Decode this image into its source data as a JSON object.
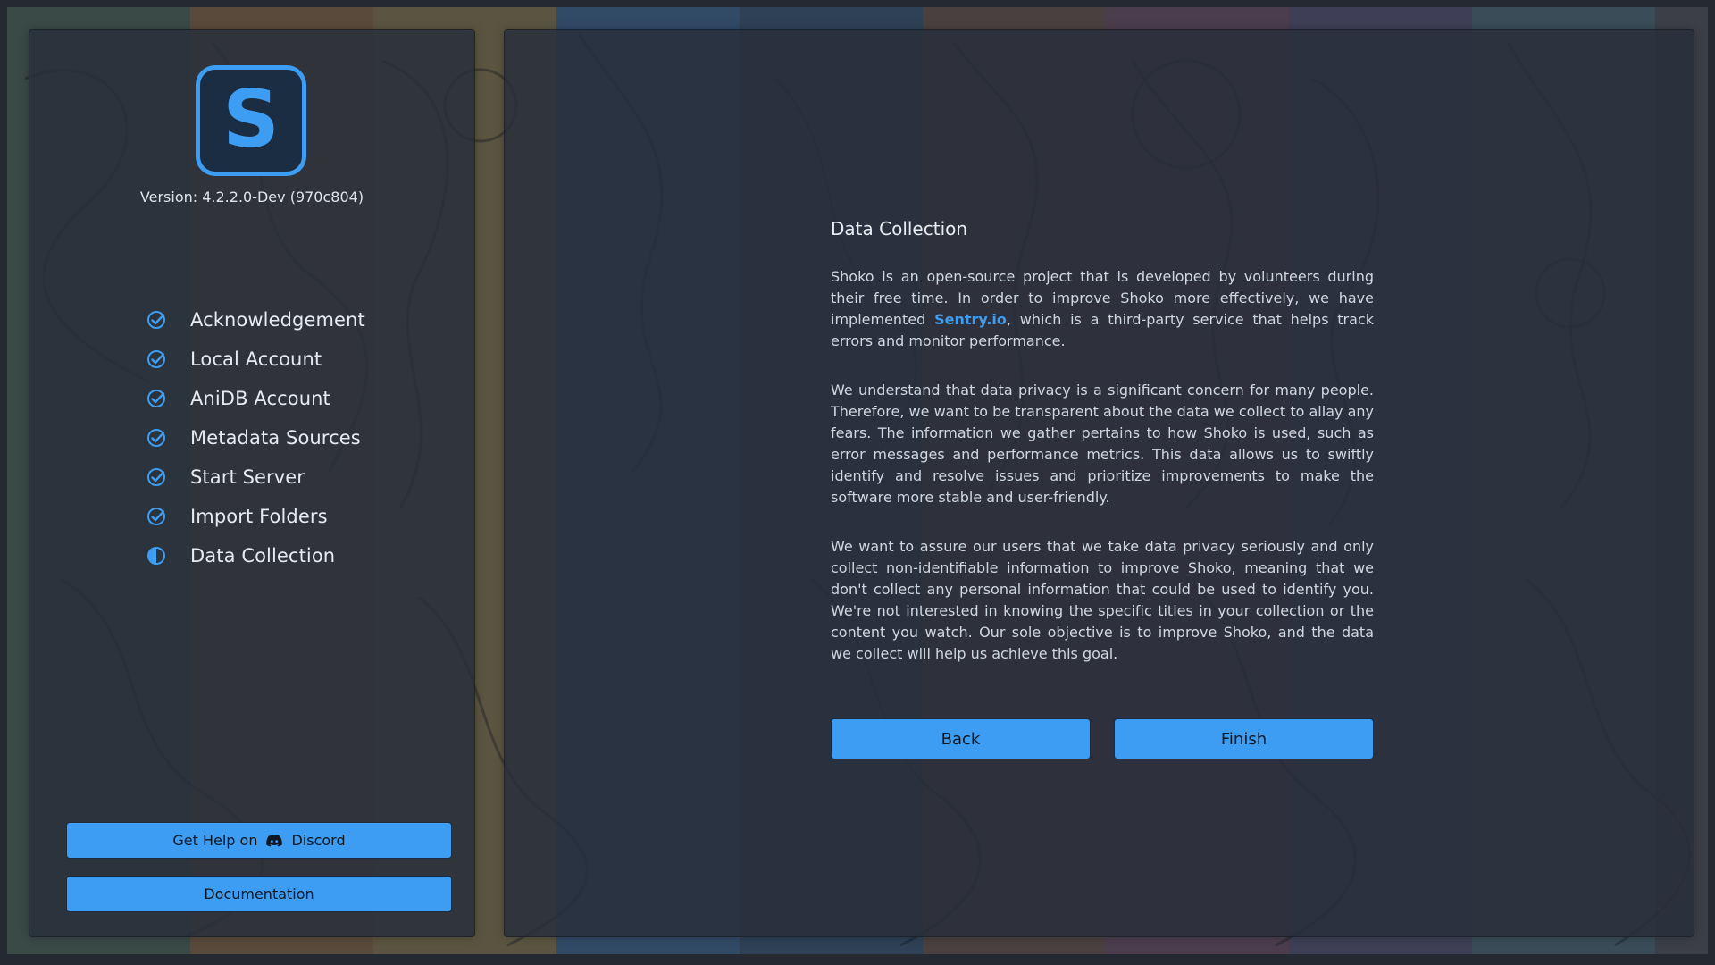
{
  "app": {
    "version_text": "Version: 4.2.2.0-Dev (970c804)",
    "logo_letter": "S"
  },
  "sidebar": {
    "steps": [
      {
        "label": "Acknowledgement",
        "status": "complete",
        "icon": "check-circle-icon"
      },
      {
        "label": "Local Account",
        "status": "complete",
        "icon": "check-circle-icon"
      },
      {
        "label": "AniDB Account",
        "status": "complete",
        "icon": "check-circle-icon"
      },
      {
        "label": "Metadata Sources",
        "status": "complete",
        "icon": "check-circle-icon"
      },
      {
        "label": "Start Server",
        "status": "complete",
        "icon": "check-circle-icon"
      },
      {
        "label": "Import Folders",
        "status": "complete",
        "icon": "check-circle-icon"
      },
      {
        "label": "Data Collection",
        "status": "current",
        "icon": "half-circle-icon"
      }
    ],
    "help_prefix": "Get Help on",
    "help_service": "Discord",
    "docs_label": "Documentation"
  },
  "main": {
    "title": "Data Collection",
    "para1_before": "Shoko is an open-source project that is developed by volunteers during their free time. In order to improve Shoko more effectively, we have implemented ",
    "para1_link": "Sentry.io",
    "para1_after": ", which is a third-party service that helps track errors and monitor performance.",
    "para2": "We understand that data privacy is a significant concern for many people. Therefore, we want to be transparent about the data we collect to allay any fears. The information we gather pertains to how Shoko is used, such as error messages and performance metrics. This data allows us to swiftly identify and resolve issues and prioritize improvements to make the software more stable and user-friendly.",
    "para3": "We want to assure our users that we take data privacy seriously and only collect non-identifiable information to improve Shoko, meaning that we don't collect any personal information that could be used to identify you. We're not interested in knowing the specific titles in your collection or the content you watch. Our sole objective is to improve Shoko, and the data we collect will help us achieve this goal.",
    "back_label": "Back",
    "finish_label": "Finish"
  },
  "colors": {
    "accent": "#3d9df2",
    "panel": "#2a313c",
    "text": "#e6ebf1"
  }
}
